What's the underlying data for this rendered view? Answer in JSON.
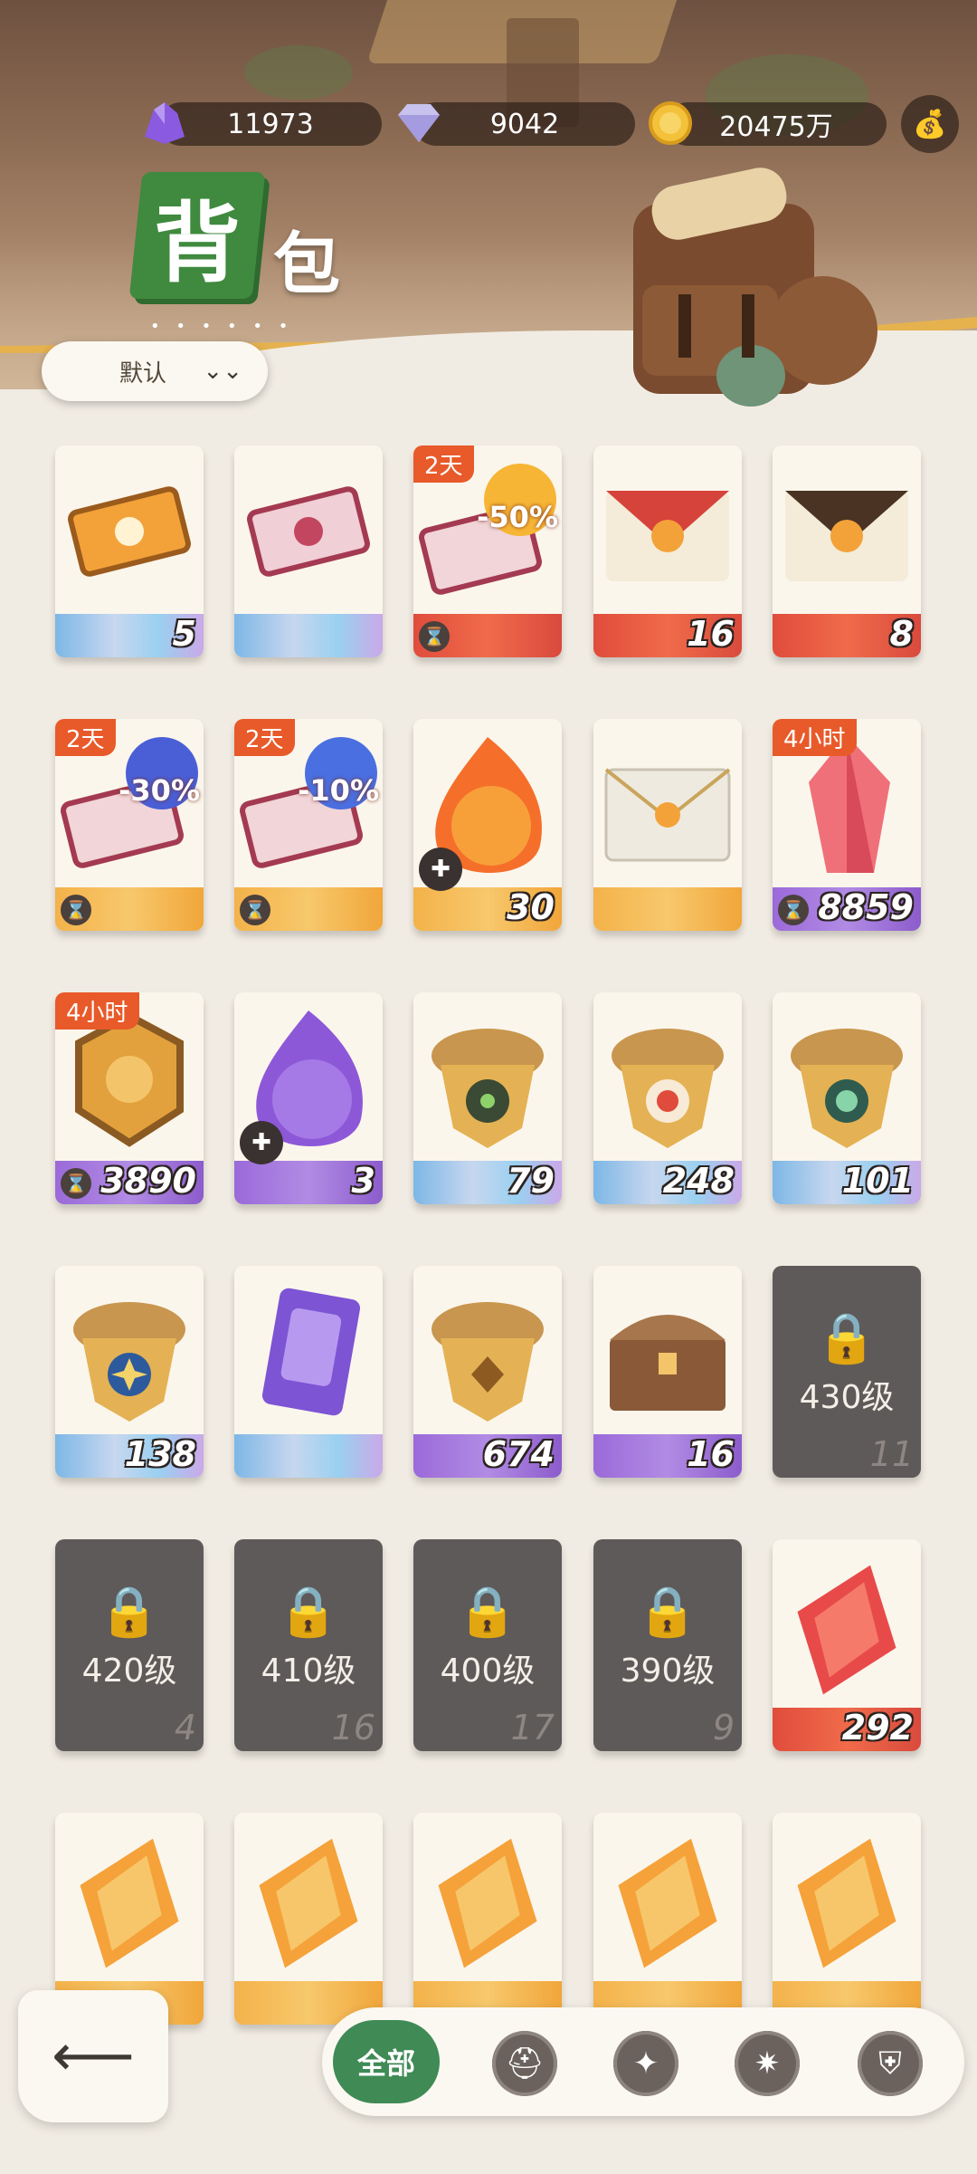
{
  "header": {
    "title_first": "背",
    "title_second": "包",
    "title_dots": "• • • • • •"
  },
  "resources": [
    {
      "name": "purple-crystal",
      "value": "11973"
    },
    {
      "name": "diamond",
      "value": "9042"
    },
    {
      "name": "gold-coin",
      "value": "20475万"
    }
  ],
  "sort": {
    "label": "默认",
    "chevron": "⌄⌄"
  },
  "items": [
    {
      "count": "5",
      "tag": "",
      "base": "blue",
      "icon": "orange-ticket-icon"
    },
    {
      "count": "",
      "tag": "",
      "base": "blue",
      "icon": "pink-ticket-icon"
    },
    {
      "count": "",
      "tag": "2天",
      "base": "red",
      "icon": "discount-ticket-50-icon",
      "badge": "-50%",
      "timer": true
    },
    {
      "count": "16",
      "tag": "",
      "base": "red",
      "icon": "red-envelope-icon"
    },
    {
      "count": "8",
      "tag": "",
      "base": "red",
      "icon": "brown-envelope-icon"
    },
    {
      "count": "",
      "tag": "2天",
      "base": "gold",
      "icon": "discount-ticket-30-icon",
      "badge": "-30%",
      "timer": true
    },
    {
      "count": "",
      "tag": "2天",
      "base": "gold",
      "icon": "discount-ticket-10-icon",
      "badge": "-10%",
      "timer": true
    },
    {
      "count": "30",
      "tag": "",
      "base": "gold",
      "icon": "fire-orb-icon",
      "puzzle": true
    },
    {
      "count": "",
      "tag": "",
      "base": "gold",
      "icon": "white-envelope-icon"
    },
    {
      "count": "8859",
      "tag": "4小时",
      "base": "purple",
      "icon": "red-crystal-icon",
      "timer": true
    },
    {
      "count": "3890",
      "tag": "4小时",
      "base": "purple",
      "icon": "fairy-tail-badge-icon",
      "timer": true
    },
    {
      "count": "3",
      "tag": "",
      "base": "purple",
      "icon": "purple-orb-icon",
      "puzzle": true
    },
    {
      "count": "79",
      "tag": "",
      "base": "blue",
      "icon": "acorn-green-eye-icon"
    },
    {
      "count": "248",
      "tag": "",
      "base": "blue",
      "icon": "acorn-red-target-icon"
    },
    {
      "count": "101",
      "tag": "",
      "base": "blue",
      "icon": "acorn-leaf-icon"
    },
    {
      "count": "138",
      "tag": "",
      "base": "blue",
      "icon": "acorn-star-icon"
    },
    {
      "count": "",
      "tag": "",
      "base": "blue",
      "icon": "purple-card-icon"
    },
    {
      "count": "674",
      "tag": "",
      "base": "purple",
      "icon": "acorn-diamond-icon"
    },
    {
      "count": "16",
      "tag": "",
      "base": "purple",
      "icon": "treasure-chest-icon"
    },
    {
      "count": "11",
      "tag": "",
      "base": "locked",
      "icon": "lock-icon",
      "level": "430级"
    },
    {
      "count": "4",
      "tag": "",
      "base": "locked",
      "icon": "lock-icon",
      "level": "420级"
    },
    {
      "count": "16",
      "tag": "",
      "base": "locked",
      "icon": "lock-icon",
      "level": "410级"
    },
    {
      "count": "17",
      "tag": "",
      "base": "locked",
      "icon": "lock-icon",
      "level": "400级"
    },
    {
      "count": "9",
      "tag": "",
      "base": "locked",
      "icon": "lock-icon",
      "level": "390级"
    },
    {
      "count": "292",
      "tag": "",
      "base": "red",
      "icon": "red-gem-icon"
    },
    {
      "count": "",
      "tag": "",
      "base": "gold",
      "icon": "orange-gem-icon"
    },
    {
      "count": "",
      "tag": "",
      "base": "gold",
      "icon": "orange-gem-icon"
    },
    {
      "count": "",
      "tag": "",
      "base": "gold",
      "icon": "orange-gem-icon"
    },
    {
      "count": "",
      "tag": "",
      "base": "gold",
      "icon": "orange-gem-icon"
    },
    {
      "count": "",
      "tag": "",
      "base": "gold",
      "icon": "orange-gem-icon"
    }
  ],
  "bottom": {
    "back_icon": "back-arrow-icon",
    "tab_all_label": "全部",
    "tabs": [
      "helmet-icon",
      "star-badge-icon",
      "compass-icon",
      "sword-shield-icon"
    ]
  },
  "colors": {
    "accent_green": "#3f8a55",
    "tag_orange": "#e85a2a"
  }
}
